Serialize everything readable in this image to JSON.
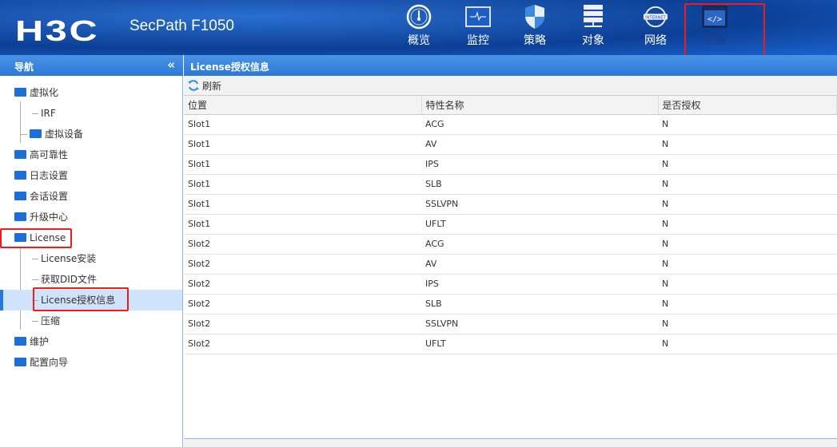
{
  "header": {
    "logo": "H3C",
    "product": "SecPath F1050",
    "menu": [
      {
        "label": "概览",
        "icon": "gauge-icon"
      },
      {
        "label": "监控",
        "icon": "monitor-icon"
      },
      {
        "label": "策略",
        "icon": "shield-icon"
      },
      {
        "label": "对象",
        "icon": "server-icon"
      },
      {
        "label": "网络",
        "icon": "internet-icon"
      },
      {
        "label": "系统",
        "icon": "code-window-icon"
      }
    ]
  },
  "nav": {
    "title": "导航",
    "collapse": "«",
    "items": [
      {
        "label": "虚拟化",
        "level": 0,
        "open": true
      },
      {
        "label": "IRF",
        "level": 1
      },
      {
        "label": "虚拟设备",
        "level": 1,
        "folder": true
      },
      {
        "label": "高可靠性",
        "level": 0
      },
      {
        "label": "日志设置",
        "level": 0
      },
      {
        "label": "会话设置",
        "level": 0
      },
      {
        "label": "升级中心",
        "level": 0
      },
      {
        "label": "License",
        "level": 0,
        "open": true
      },
      {
        "label": "License安装",
        "level": 1
      },
      {
        "label": "获取DID文件",
        "level": 1
      },
      {
        "label": "License授权信息",
        "level": 1,
        "selected": true
      },
      {
        "label": "压缩",
        "level": 1
      },
      {
        "label": "维护",
        "level": 0
      },
      {
        "label": "配置向导",
        "level": 0
      }
    ]
  },
  "main": {
    "title": "License授权信息",
    "refresh": "刷新",
    "columns": [
      "位置",
      "特性名称",
      "是否授权"
    ],
    "rows": [
      [
        "Slot1",
        "ACG",
        "N"
      ],
      [
        "Slot1",
        "AV",
        "N"
      ],
      [
        "Slot1",
        "IPS",
        "N"
      ],
      [
        "Slot1",
        "SLB",
        "N"
      ],
      [
        "Slot1",
        "SSLVPN",
        "N"
      ],
      [
        "Slot1",
        "UFLT",
        "N"
      ],
      [
        "Slot2",
        "ACG",
        "N"
      ],
      [
        "Slot2",
        "AV",
        "N"
      ],
      [
        "Slot2",
        "IPS",
        "N"
      ],
      [
        "Slot2",
        "SLB",
        "N"
      ],
      [
        "Slot2",
        "SSLVPN",
        "N"
      ],
      [
        "Slot2",
        "UFLT",
        "N"
      ]
    ]
  }
}
